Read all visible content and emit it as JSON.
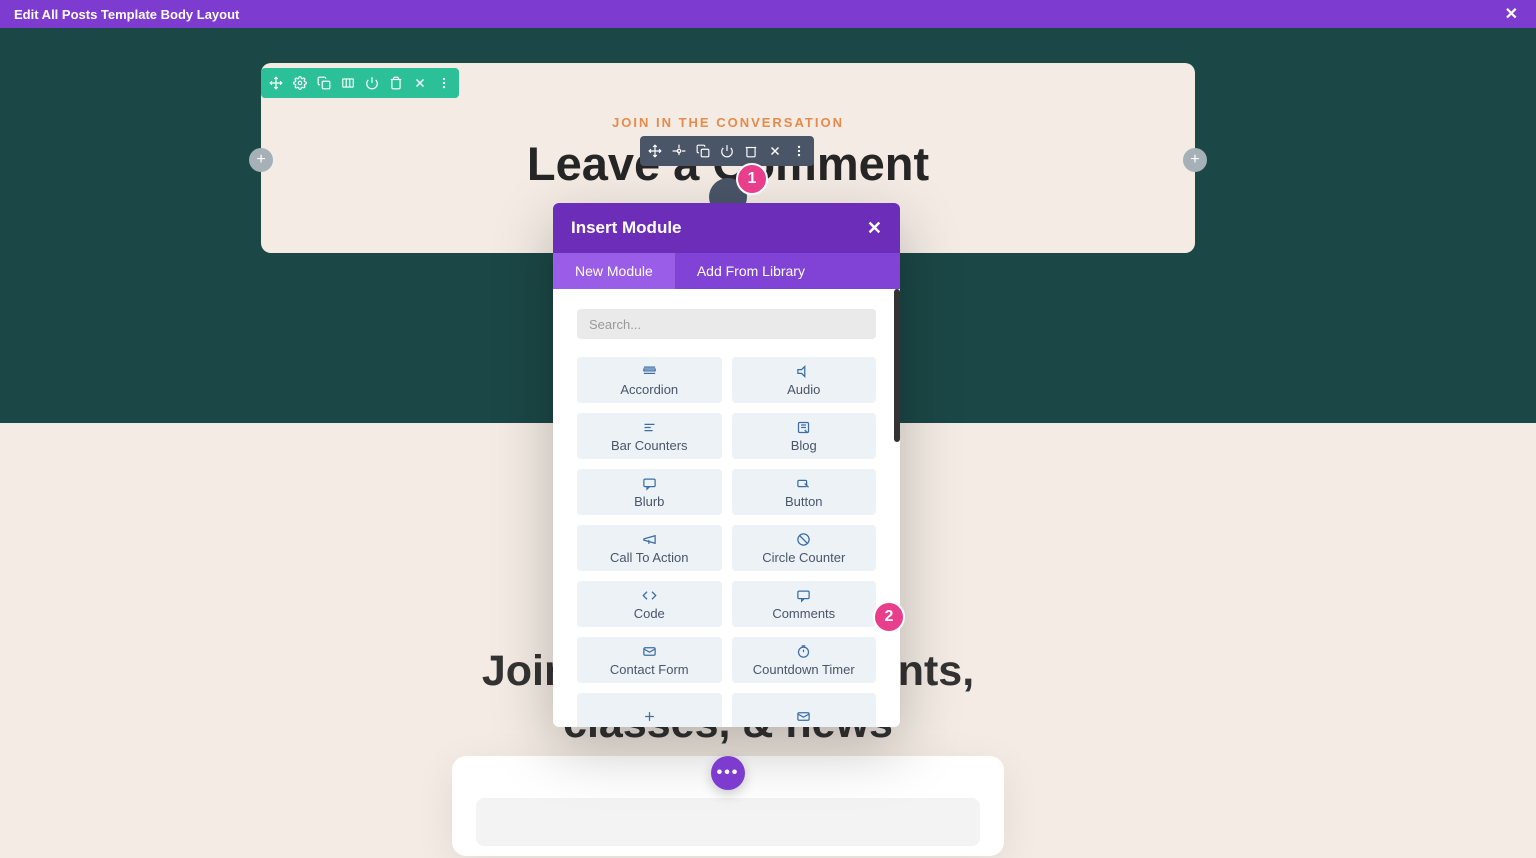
{
  "topbar": {
    "title": "Edit All Posts Template Body Layout"
  },
  "section1": {
    "eyebrow": "JOIN IN THE CONVERSATION",
    "heading": "Leave a Comment"
  },
  "section2": {
    "line1": "Join for recipes, events,",
    "line2": "classes, & news"
  },
  "modal": {
    "title": "Insert Module",
    "tabs": {
      "new": "New Module",
      "lib": "Add From Library"
    },
    "search_placeholder": "Search...",
    "modules": [
      {
        "key": "accordion",
        "label": "Accordion"
      },
      {
        "key": "audio",
        "label": "Audio"
      },
      {
        "key": "barcounters",
        "label": "Bar Counters"
      },
      {
        "key": "blog",
        "label": "Blog"
      },
      {
        "key": "blurb",
        "label": "Blurb"
      },
      {
        "key": "button",
        "label": "Button"
      },
      {
        "key": "cta",
        "label": "Call To Action"
      },
      {
        "key": "circlecounter",
        "label": "Circle Counter"
      },
      {
        "key": "code",
        "label": "Code"
      },
      {
        "key": "comments",
        "label": "Comments"
      },
      {
        "key": "contactform",
        "label": "Contact Form"
      },
      {
        "key": "countdown",
        "label": "Countdown Timer"
      }
    ]
  },
  "badges": {
    "one": "1",
    "two": "2"
  }
}
